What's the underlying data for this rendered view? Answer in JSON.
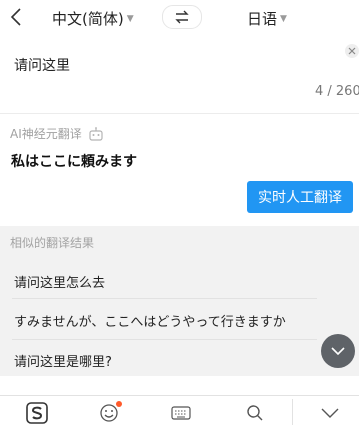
{
  "header": {
    "source_lang": "中文(简体)",
    "target_lang": "日语",
    "icons": {
      "back": "back-arrow-icon",
      "swap": "swap-icon",
      "dropdown": "caret-down-icon"
    }
  },
  "input": {
    "text": "请问这里",
    "char_count": "4 / 260"
  },
  "result": {
    "engine_label": "AI神经元翻译",
    "text": "私はここに頼みます",
    "human_translate_button": "实时人工翻译",
    "accent_color": "#2196f3"
  },
  "similar": {
    "title": "相似的翻译结果",
    "items": [
      "请问这里怎么去",
      "すみませんが、ここへはどうやって行きますか",
      "请问这里是哪里?"
    ]
  },
  "keyboard_bar": {
    "icons": [
      "sogou-logo-icon",
      "emoji-icon",
      "keyboard-icon",
      "search-icon",
      "collapse-icon"
    ],
    "notification_color": "#ff5a2b"
  }
}
